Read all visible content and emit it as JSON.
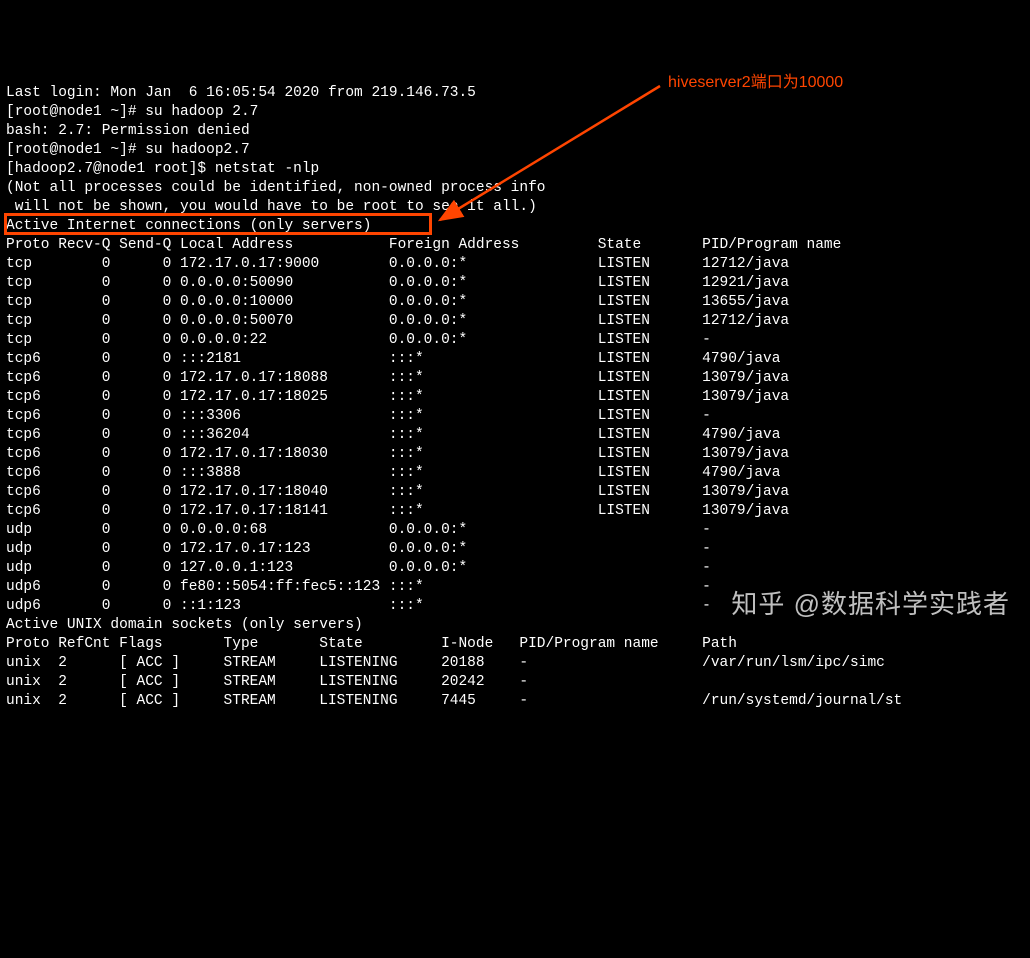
{
  "lines": [
    "Last login: Mon Jan  6 16:05:54 2020 from 219.146.73.5",
    "[root@node1 ~]# su hadoop 2.7",
    "bash: 2.7: Permission denied",
    "[root@node1 ~]# su hadoop2.7",
    "[hadoop2.7@node1 root]$ netstat -nlp",
    "(Not all processes could be identified, non-owned process info",
    " will not be shown, you would have to be root to see it all.)",
    "Active Internet connections (only servers)",
    "Proto Recv-Q Send-Q Local Address           Foreign Address         State       PID/Program name   ",
    "tcp        0      0 172.17.0.17:9000        0.0.0.0:*               LISTEN      12712/java         ",
    "tcp        0      0 0.0.0.0:50090           0.0.0.0:*               LISTEN      12921/java         ",
    "tcp        0      0 0.0.0.0:10000           0.0.0.0:*               LISTEN      13655/java         ",
    "tcp        0      0 0.0.0.0:50070           0.0.0.0:*               LISTEN      12712/java         ",
    "tcp        0      0 0.0.0.0:22              0.0.0.0:*               LISTEN      -                  ",
    "tcp6       0      0 :::2181                 :::*                    LISTEN      4790/java          ",
    "tcp6       0      0 172.17.0.17:18088       :::*                    LISTEN      13079/java         ",
    "tcp6       0      0 172.17.0.17:18025       :::*                    LISTEN      13079/java         ",
    "tcp6       0      0 :::3306                 :::*                    LISTEN      -                  ",
    "tcp6       0      0 :::36204                :::*                    LISTEN      4790/java          ",
    "tcp6       0      0 172.17.0.17:18030       :::*                    LISTEN      13079/java         ",
    "tcp6       0      0 :::3888                 :::*                    LISTEN      4790/java          ",
    "tcp6       0      0 172.17.0.17:18040       :::*                    LISTEN      13079/java         ",
    "tcp6       0      0 172.17.0.17:18141       :::*                    LISTEN      13079/java         ",
    "udp        0      0 0.0.0.0:68              0.0.0.0:*                           -                  ",
    "udp        0      0 172.17.0.17:123         0.0.0.0:*                           -                  ",
    "udp        0      0 127.0.0.1:123           0.0.0.0:*                           -                  ",
    "udp6       0      0 fe80::5054:ff:fec5::123 :::*                                -                  ",
    "udp6       0      0 ::1:123                 :::*                                -                  ",
    "Active UNIX domain sockets (only servers)",
    "Proto RefCnt Flags       Type       State         I-Node   PID/Program name     Path",
    "unix  2      [ ACC ]     STREAM     LISTENING     20188    -                    /var/run/lsm/ipc/simc",
    "unix  2      [ ACC ]     STREAM     LISTENING     20242    -                    ",
    "unix  2      [ ACC ]     STREAM     LISTENING     7445     -                    /run/systemd/journal/st"
  ],
  "annotation": "hiveserver2端口为10000",
  "watermark": "知乎 @数据科学实践者"
}
